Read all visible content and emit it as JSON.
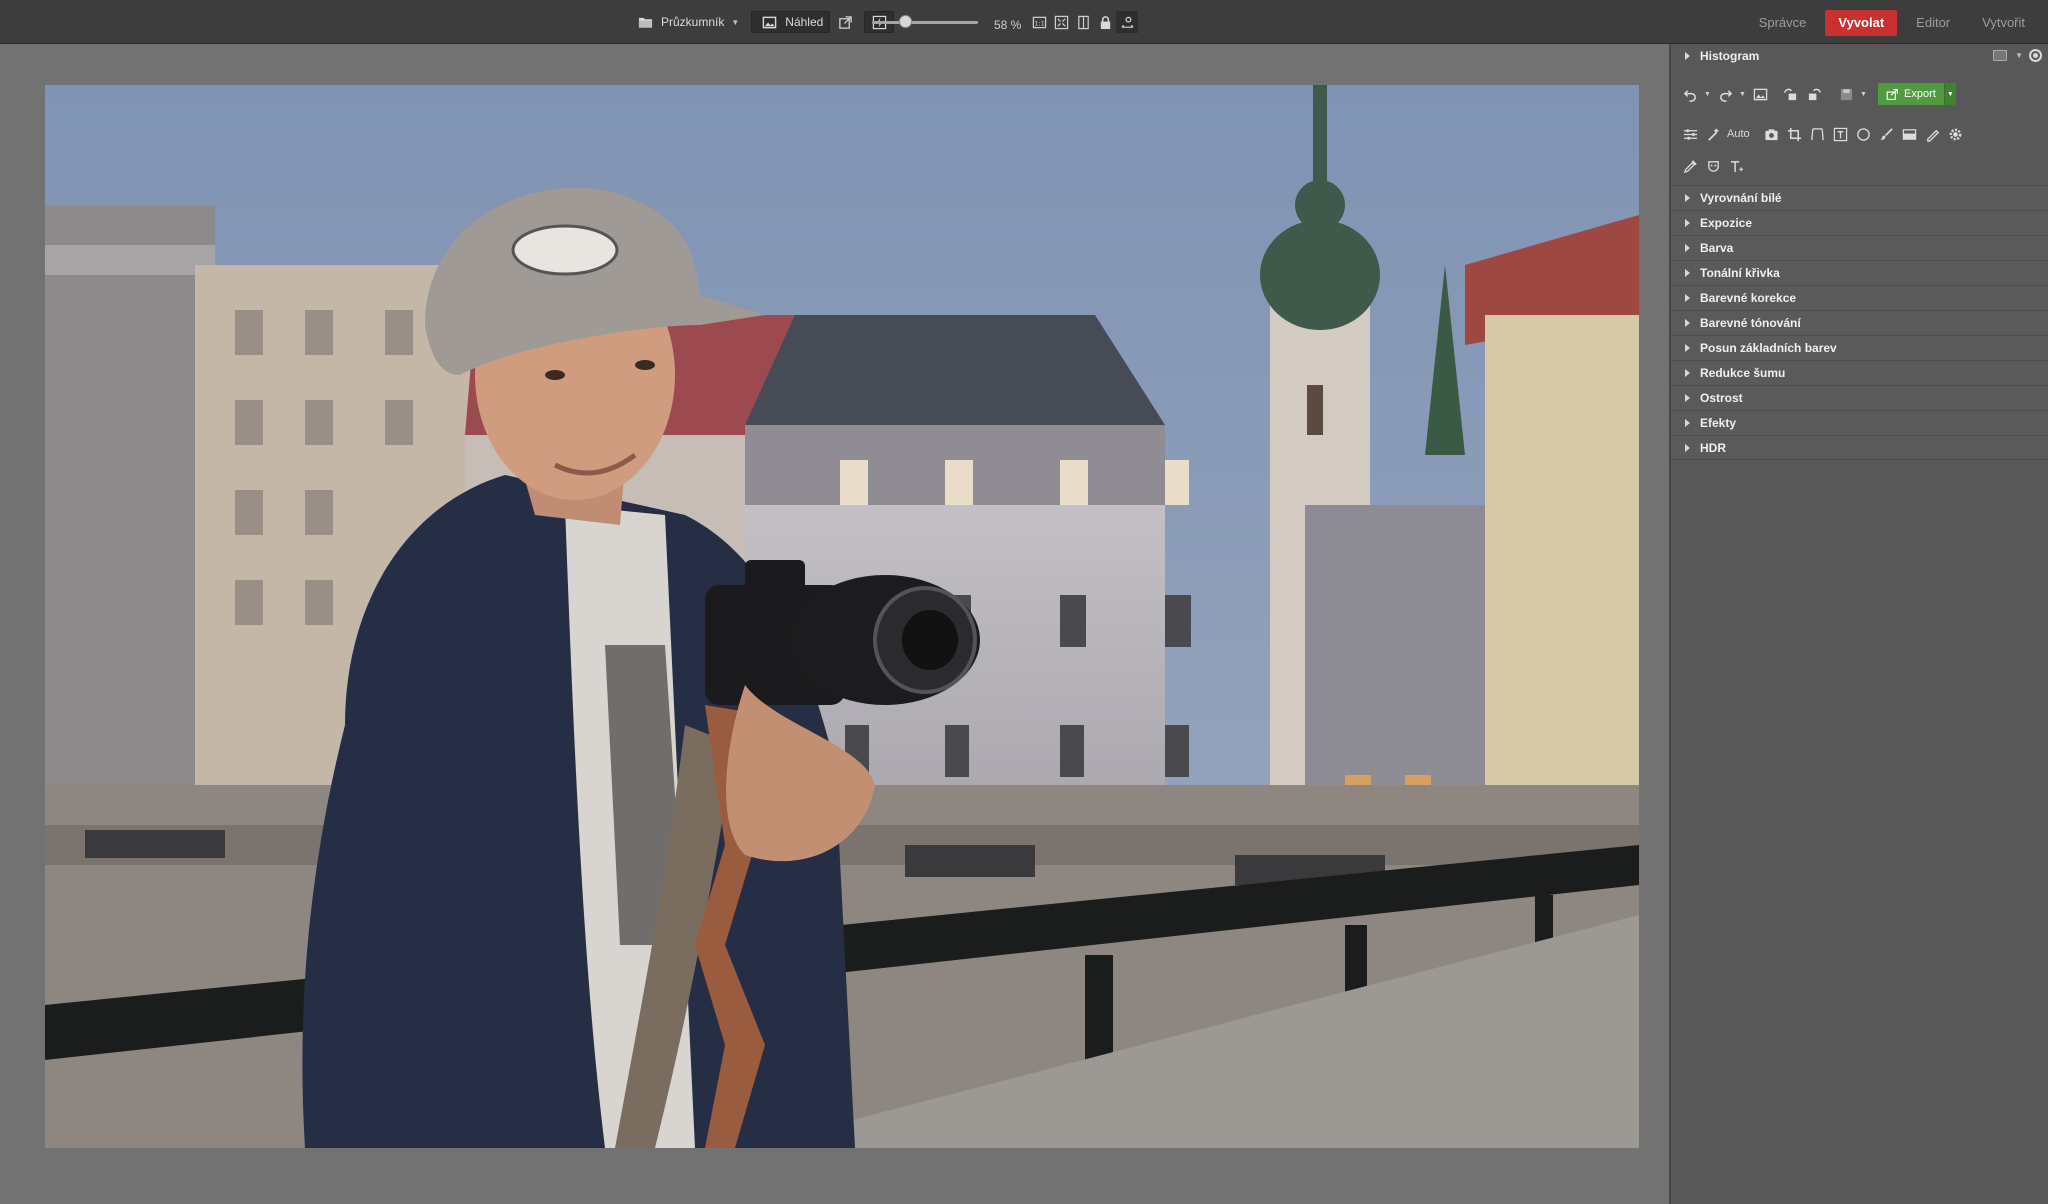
{
  "toolbar": {
    "browser_label": "Průzkumník",
    "preview_label": "Náhled",
    "zoom_label": "58 %",
    "zoom_value": 0.58
  },
  "modes": [
    {
      "label": "Správce",
      "active": false
    },
    {
      "label": "Vyvolat",
      "active": true
    },
    {
      "label": "Editor",
      "active": false
    },
    {
      "label": "Vytvořit",
      "active": false
    }
  ],
  "panel": {
    "histogram_label": "Histogram",
    "export_label": "Export",
    "auto_label": "Auto",
    "sections": [
      "Vyrovnání bílé",
      "Expozice",
      "Barva",
      "Tonální křivka",
      "Barevné korekce",
      "Barevné tónování",
      "Posun základních barev",
      "Redukce šumu",
      "Ostrost",
      "Efekty",
      "HDR"
    ]
  },
  "colors": {
    "accent_active": "#c8312e",
    "export_green": "#4f9b3d",
    "panel_bg": "#585858",
    "toolbar_bg": "#3d3d3d"
  },
  "icons": {
    "browser": "folder-icon",
    "preview": "image-icon",
    "external": "open-external-icon",
    "flash": "flash-icon",
    "fit_1to1": "actual-size-icon",
    "fit_screen": "fit-screen-icon",
    "compare": "compare-icon",
    "lock": "lock-icon",
    "swap": "swap-icon"
  }
}
